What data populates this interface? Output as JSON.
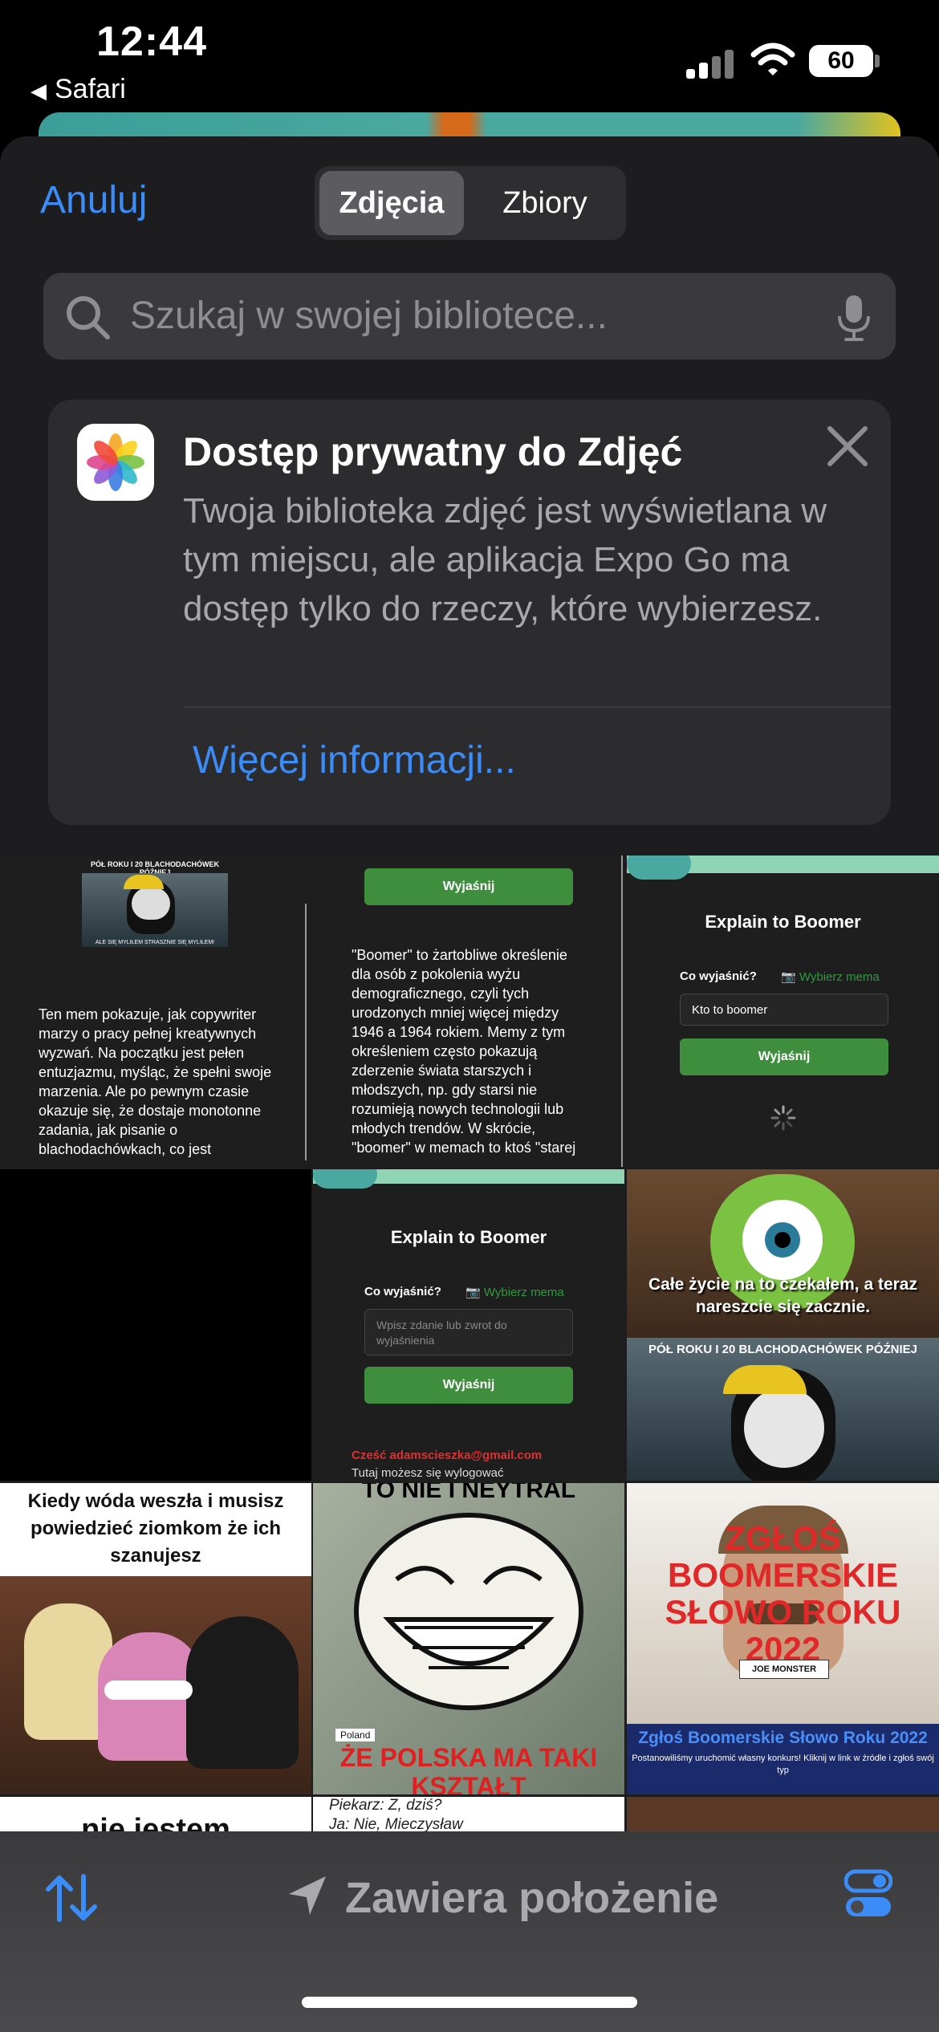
{
  "status_bar": {
    "time": "12:44",
    "back_app": "Safari",
    "battery": "60"
  },
  "picker": {
    "cancel_label": "Anuluj",
    "segments": [
      "Zdjęcia",
      "Zbiory"
    ],
    "search_placeholder": "Szukaj w swojej bibliotece..."
  },
  "privacy_card": {
    "title": "Dostęp prywatny do Zdjęć",
    "body": "Twoja biblioteka zdjęć jest wyświetlana w tym miejscu, ale aplikacja Expo Go ma dostęp tylko do rzeczy, które wybierzesz.",
    "link": "Więcej informacji..."
  },
  "grid": {
    "t1": {
      "meme_top": "PÓŁ ROKU I 20 BLACHODACHÓWEK PÓŹNIEJ",
      "meme_bottom": "ALE SIĘ MYLIŁEM STRASZNIE SIĘ MYLIŁEM!",
      "text": "Ten mem pokazuje, jak copywriter marzy o pracy pełnej kreatywnych wyzwań. Na początku jest pełen entuzjazmu, myśląc, że spełni swoje marzenia. Ale po pewnym czasie okazuje się, że dostaje monotonne zadania, jak pisanie o blachodachówkach, co jest"
    },
    "t2": {
      "button": "Wyjaśnij",
      "text": "\"Boomer\" to żartobliwe określenie dla osób z pokolenia wyżu demograficznego, czyli tych urodzonych mniej więcej między 1946 a 1964 rokiem. Memy z tym określeniem często pokazują zderzenie świata starszych i młodszych, np. gdy starsi nie rozumieją nowych technologii lub młodych trendów. W skrócie, \"boomer\" w memach to ktoś \"starej"
    },
    "t3": {
      "title": "Explain to Boomer",
      "label": "Co wyjaśnić?",
      "pick": "Wybierz mema",
      "input": "Kto to boomer",
      "button": "Wyjaśnij"
    },
    "t5": {
      "title": "Explain to Boomer",
      "label": "Co wyjaśnić?",
      "pick": "Wybierz mema",
      "placeholder": "Wpisz zdanie lub zwrot do wyjaśnienia",
      "button": "Wyjaśnij",
      "greeting": "Cześć adamscieszka@gmail.com",
      "logout": "Tutaj możesz się wylogować"
    },
    "t6": {
      "caption": "Całe życie na to czekałem, a teraz nareszcie się zacznie.",
      "strip": "PÓŁ ROKU I 20 BLACHODACHÓWEK PÓŹNIEJ"
    },
    "t7": {
      "caption": "Kiedy wóda weszła i musisz powiedzieć ziomkom że ich szanujesz"
    },
    "t8": {
      "top": "TO NIE I NEYTRAL",
      "map_label": "Poland",
      "bottom": "ŻE POLSKA MA TAKI KSZTAŁT"
    },
    "t9": {
      "headline": "ZGŁOŚ BOOMERSKIE SŁOWO ROKU 2022",
      "badge": "JOE MONSTER",
      "sub": "Zgłoś Boomerskie Słowo Roku 2022",
      "small": "Postanowiliśmy uruchomić własny konkurs! Kliknij w link w źródle i zgłoś swój typ"
    },
    "t10": {
      "text": "nie jestem"
    },
    "t11": {
      "line1": "Piekarz: Z, dziś?",
      "line2": "Ja: Nie, Mieczysław"
    }
  },
  "bottom_bar": {
    "location_label": "Zawiera położenie"
  },
  "colors": {
    "accent": "#3b8cf6",
    "sheet": "#1d1d1f",
    "button_green": "#3e8e3e"
  }
}
